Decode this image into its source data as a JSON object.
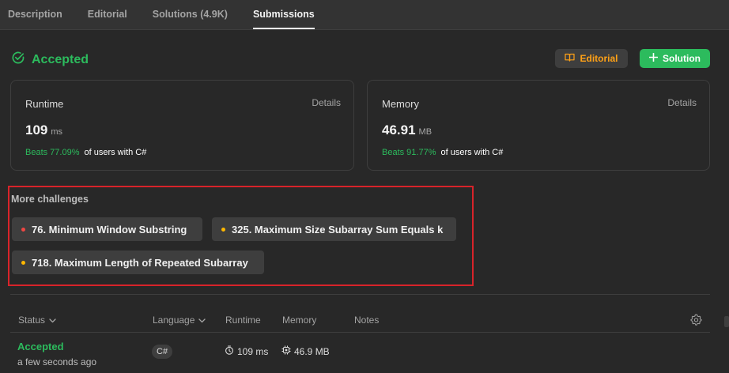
{
  "tabs": [
    {
      "label": "Description"
    },
    {
      "label": "Editorial"
    },
    {
      "label": "Solutions (4.9K)"
    },
    {
      "label": "Submissions",
      "active": true
    }
  ],
  "result": {
    "status": "Accepted",
    "editorial_button": "Editorial",
    "solution_button": "Solution"
  },
  "runtime_card": {
    "label": "Runtime",
    "details": "Details",
    "value": "109",
    "unit": "ms",
    "beats_pct": "Beats 77.09%",
    "beats_suffix": "of users with C#"
  },
  "memory_card": {
    "label": "Memory",
    "details": "Details",
    "value": "46.91",
    "unit": "MB",
    "beats_pct": "Beats 91.77%",
    "beats_suffix": "of users with C#"
  },
  "more_challenges": {
    "label": "More challenges",
    "items": [
      {
        "title": "76. Minimum Window Substring",
        "difficulty_color": "#ef4743"
      },
      {
        "title": "325. Maximum Size Subarray Sum Equals k",
        "difficulty_color": "#ffb800"
      },
      {
        "title": "718. Maximum Length of Repeated Subarray",
        "difficulty_color": "#ffb800"
      }
    ]
  },
  "submissions_table": {
    "headers": {
      "status": "Status",
      "language": "Language",
      "runtime": "Runtime",
      "memory": "Memory",
      "notes": "Notes"
    },
    "rows": [
      {
        "status": "Accepted",
        "time": "a few seconds ago",
        "language": "C#",
        "runtime": "109 ms",
        "memory": "46.9 MB"
      }
    ]
  },
  "colors": {
    "accepted_green": "#2cbb5d",
    "editorial_orange": "#ffa116",
    "highlight_red": "#d8232a"
  },
  "icons": {
    "accepted": "check-circle-icon",
    "editorial": "book-icon",
    "solution": "plus-icon",
    "sort": "chevron-down-icon",
    "runtime": "stopwatch-icon",
    "memory": "chip-icon",
    "settings": "gear-icon"
  }
}
